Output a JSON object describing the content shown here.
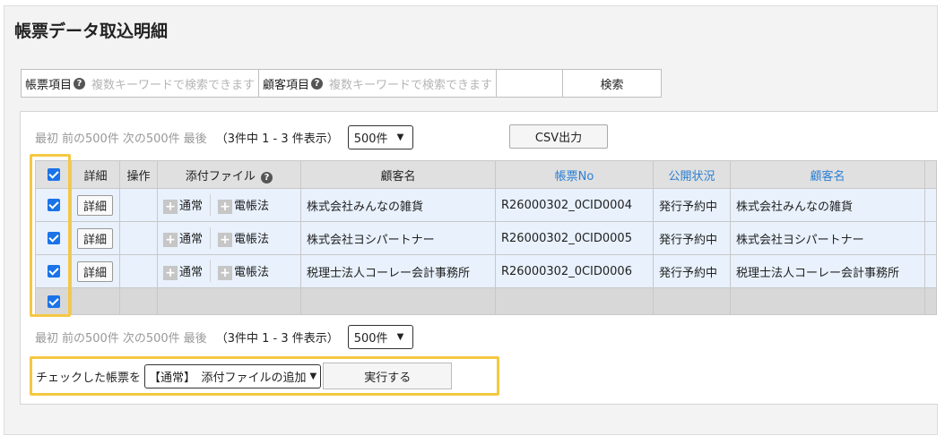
{
  "page_title": "帳票データ取込明細",
  "search": {
    "form_label": "帳票項目",
    "form_placeholder": "複数キーワードで検索できます",
    "customer_label": "顧客項目",
    "customer_placeholder": "複数キーワードで検索できます",
    "button": "検索"
  },
  "pager": {
    "first": "最初",
    "prev": "前の500件",
    "next": "次の500件",
    "last": "最後",
    "count": "（3件中 1 - 3 件表示）",
    "per_page": "500件"
  },
  "csv_button": "CSV出力",
  "table": {
    "headers": {
      "detail": "詳細",
      "action": "操作",
      "attachment": "添付ファイル",
      "customer1": "顧客名",
      "form_no": "帳票No",
      "status": "公開状況",
      "customer2": "顧客名"
    },
    "detail_label": "詳細",
    "attach_normal": "通常",
    "attach_ledger": "電帳法",
    "rows": [
      {
        "customer": "株式会社みんなの雑貨",
        "form_no": "R26000302_0CID0004",
        "status": "発行予約中",
        "customer2": "株式会社みんなの雑貨"
      },
      {
        "customer": "株式会社ヨシパートナー",
        "form_no": "R26000302_0CID0005",
        "status": "発行予約中",
        "customer2": "株式会社ヨシパートナー"
      },
      {
        "customer": "税理士法人コーレー会計事務所",
        "form_no": "R26000302_0CID0006",
        "status": "発行予約中",
        "customer2": "税理士法人コーレー会計事務所"
      }
    ]
  },
  "bulk_action": {
    "label": "チェックした帳票を",
    "selected": "【通常】　添付ファイルの追加",
    "run_button": "実行する"
  },
  "colors": {
    "highlight": "#f5c842",
    "checkbox": "#1a73e8",
    "link": "#2a7fd4",
    "row_bg": "#e8f1fc"
  }
}
